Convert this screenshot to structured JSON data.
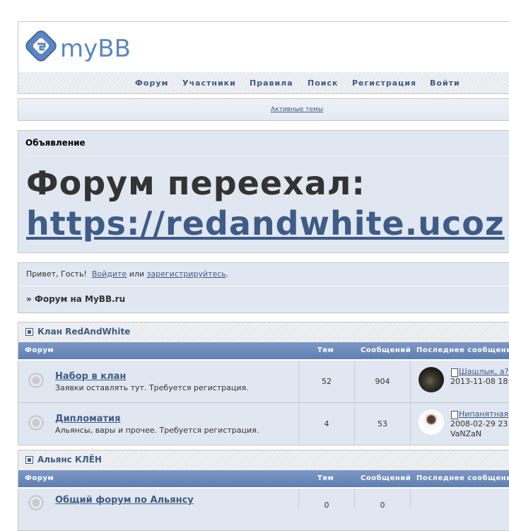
{
  "header": {
    "logo_text": "myBB"
  },
  "nav": [
    "Форум",
    "Участники",
    "Правила",
    "Поиск",
    "Регистрация",
    "Войти"
  ],
  "active_topics": "Активные темы",
  "announcement": {
    "title": "Объявление",
    "headline": "Форум переехал:",
    "link": "https://redandwhite.ucoz"
  },
  "welcome": {
    "greeting": "Привет, Гость!",
    "login": "Войдите",
    "or": "или",
    "register": "зарегистрируйтесь",
    "dot": "."
  },
  "breadcrumb": "» Форум на MyBB.ru",
  "columns": {
    "forum": "Форум",
    "topics": "Тем",
    "posts": "Сообщений",
    "last": "Последнее сообщени"
  },
  "categories": [
    {
      "title": "Клан RedAndWhite",
      "forums": [
        {
          "name": "Набор в клан",
          "desc": "Заявки оставлять тут. Требуется регистрация.",
          "topics": "52",
          "posts": "904",
          "last_title": "Шашлык, а?",
          "last_date": "2013-11-08 18:",
          "last_author": ""
        },
        {
          "name": "Дипломатия",
          "desc": "Альянсы, вары и прочее. Требуется регистрация.",
          "topics": "4",
          "posts": "53",
          "last_title": "Нипанятная",
          "last_date": "2008-02-29 23",
          "last_author": "VaNZaN"
        }
      ]
    },
    {
      "title": "Альянс КЛЁН",
      "forums": [
        {
          "name": "Общий форум по Альянсу",
          "desc": "",
          "topics": "0",
          "posts": "0",
          "last_title": "",
          "last_date": "",
          "last_author": ""
        }
      ]
    }
  ],
  "colors": {
    "accent": "#3f5b87",
    "panel": "#e1e7f0",
    "thead": "#6a88b8"
  }
}
